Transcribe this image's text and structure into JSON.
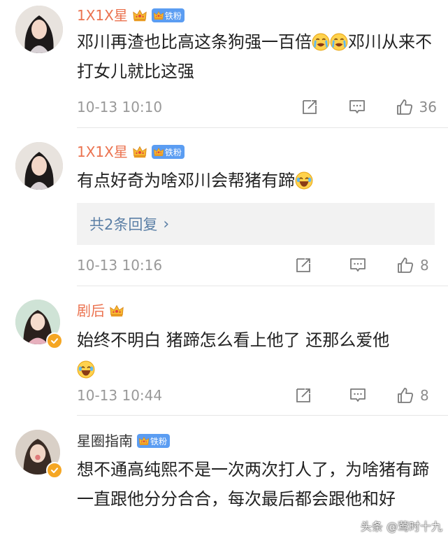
{
  "comments": [
    {
      "username": "1X1X星",
      "fan_badge": "铁粉",
      "text_parts": [
        "邓川再渣也比高这条狗强一百倍",
        "邓川从来不打女儿就比这强"
      ],
      "time": "10-13 10:10",
      "likes": "36"
    },
    {
      "username": "1X1X星",
      "fan_badge": "铁粉",
      "text": "有点好奇为啥邓川会帮猪有蹄",
      "replies_label": "共2条回复",
      "time": "10-13 10:16",
      "likes": "8"
    },
    {
      "username": "剧后",
      "text": "始终不明白  猪蹄怎么看上他了 还那么爱他",
      "time": "10-13 10:44",
      "likes": "8"
    },
    {
      "username": "星圈指南",
      "fan_badge": "铁粉",
      "text": "想不通高纯熙不是一次两次打人了，为啥猪有蹄一直跟他分分合合，每次最后都会跟他和好"
    }
  ],
  "watermark": "头条 @莺时十九",
  "icons": {
    "repost": "repost-icon",
    "comment": "comment-icon",
    "like": "like-icon",
    "crown": "crown-icon",
    "emoji_crying": "crying-emoji-icon",
    "emoji_laughing": "laugh-cry-emoji-icon",
    "verified": "verified-badge-icon"
  },
  "colors": {
    "vip_name": "#eb7350",
    "fan_badge": "#5b9df2",
    "link": "#5b7fa6",
    "meta": "#999999",
    "verified_badge": "#f5a623"
  }
}
